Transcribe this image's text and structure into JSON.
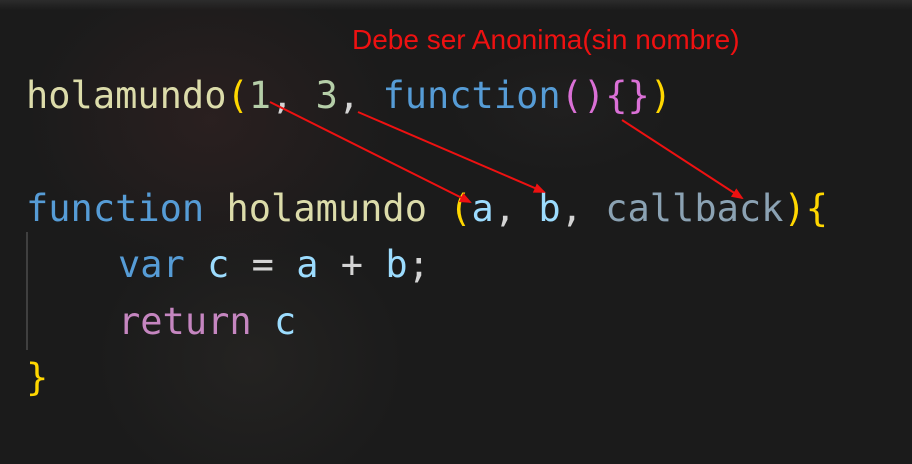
{
  "annotation": {
    "text": "Debe ser Anonima(sin nombre)",
    "color": "#ee1111"
  },
  "call_line": {
    "name": "holamundo",
    "open_paren": "(",
    "arg1": "1",
    "sep1": ", ",
    "arg2": "3",
    "sep2": ", ",
    "keyword": "function",
    "inner_parens": "()",
    "braces": "{}",
    "close_paren": ")"
  },
  "declaration_line": {
    "keyword": "function",
    "name": "holamundo",
    "open_paren": "(",
    "param1": "a",
    "sep1": ", ",
    "param2": "b",
    "sep2": ", ",
    "param3": "callback",
    "close_paren": ")",
    "open_brace": "{"
  },
  "body_line_1": {
    "keyword": "var",
    "variable": "c",
    "assign": "=",
    "operand1": "a",
    "operator": "+",
    "operand2": "b",
    "semicolon": ";"
  },
  "body_line_2": {
    "keyword": "return",
    "value": "c"
  },
  "closing_line": {
    "brace": "}"
  },
  "colors": {
    "function_name": "#dcdcaa",
    "keyword": "#569cd6",
    "control_keyword": "#c586c0",
    "number": "#b5cea8",
    "variable": "#9cdcfe",
    "bracket_level_1": "#ffd700",
    "bracket_level_2": "#da70d6",
    "bracket_level_3": "#179fff",
    "arrow": "#ee1111",
    "background": "#1e1e1e"
  }
}
